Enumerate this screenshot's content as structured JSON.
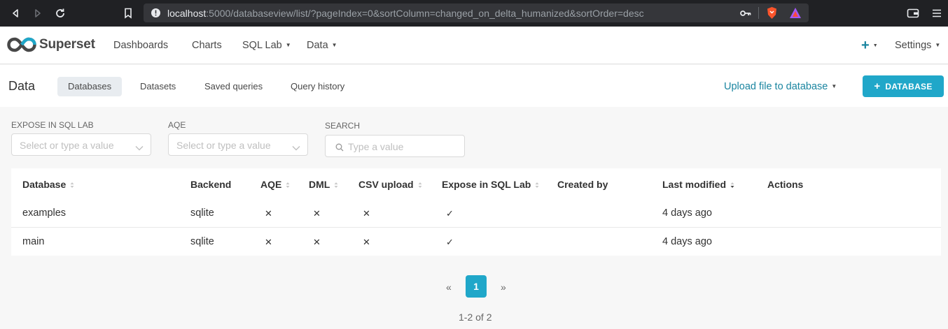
{
  "browser": {
    "url_host": "localhost",
    "url_rest": ":5000/databaseview/list/?pageIndex=0&sortColumn=changed_on_delta_humanized&sortOrder=desc"
  },
  "header": {
    "brand": "Superset",
    "nav": {
      "dashboards": "Dashboards",
      "charts": "Charts",
      "sql_lab": "SQL Lab",
      "data": "Data",
      "settings": "Settings"
    }
  },
  "subheader": {
    "title": "Data",
    "tabs": {
      "databases": "Databases",
      "datasets": "Datasets",
      "saved_queries": "Saved queries",
      "query_history": "Query history"
    },
    "upload_label": "Upload file to database",
    "database_button": "DATABASE"
  },
  "filters": {
    "expose_label": "EXPOSE IN SQL LAB",
    "expose_placeholder": "Select or type a value",
    "aqe_label": "AQE",
    "aqe_placeholder": "Select or type a value",
    "search_label": "SEARCH",
    "search_placeholder": "Type a value"
  },
  "table": {
    "columns": {
      "database": "Database",
      "backend": "Backend",
      "aqe": "AQE",
      "dml": "DML",
      "csv_upload": "CSV upload",
      "expose": "Expose in SQL Lab",
      "created_by": "Created by",
      "last_modified": "Last modified",
      "actions": "Actions"
    },
    "rows": [
      {
        "database": "examples",
        "backend": "sqlite",
        "aqe": "✕",
        "dml": "✕",
        "csv": "✕",
        "expose": "✓",
        "created_by": "",
        "last_modified": "4 days ago"
      },
      {
        "database": "main",
        "backend": "sqlite",
        "aqe": "✕",
        "dml": "✕",
        "csv": "✕",
        "expose": "✓",
        "created_by": "",
        "last_modified": "4 days ago"
      }
    ]
  },
  "pagination": {
    "prev": "«",
    "current": "1",
    "next": "»",
    "count": "1-2 of 2"
  },
  "colors": {
    "primary": "#20a7c9",
    "link": "#1a85a0"
  }
}
